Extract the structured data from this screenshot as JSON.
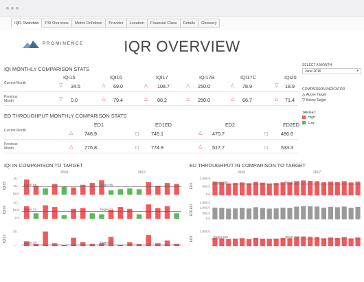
{
  "tabs": [
    "IQR Overview",
    "PSI Overview",
    "Metric Drilldown",
    "Provider",
    "Location",
    "Financial Class",
    "Details",
    "Glossary"
  ],
  "active_tab": 0,
  "brand": {
    "name": "PROMINENCE"
  },
  "page_title": "IQR OVERVIEW",
  "colors": {
    "above": "#e8484d",
    "below": "#3a9f3a",
    "high": "#f0595d",
    "low": "#5cb85c",
    "neutral": "#9a9a9a"
  },
  "iqi_section": {
    "title": "IQI MONTHLY COMPARISON STATS",
    "columns": [
      "IQI15",
      "IQI16",
      "IQI17",
      "IQI17B",
      "IQI17C",
      "IQI20"
    ],
    "rows": [
      {
        "label": "Current Month",
        "cells": [
          {
            "indicator": "down",
            "value": "34.5"
          },
          {
            "indicator": "up",
            "value": "69.0"
          },
          {
            "indicator": "up",
            "value": "108.7"
          },
          {
            "indicator": "up",
            "value": "250.0"
          },
          {
            "indicator": "up",
            "value": "78.9"
          },
          {
            "indicator": "down",
            "value": "18.9"
          }
        ]
      },
      {
        "label": "Previous Month",
        "cells": [
          {
            "indicator": "down",
            "value": "0.0"
          },
          {
            "indicator": "up",
            "value": "79.4"
          },
          {
            "indicator": "up",
            "value": "88.2"
          },
          {
            "indicator": "up",
            "value": "250.0"
          },
          {
            "indicator": "up",
            "value": "66.7"
          },
          {
            "indicator": "up",
            "value": "71.4"
          }
        ]
      }
    ]
  },
  "ed_section": {
    "title": "ED THROUGHPUT MONTHLY COMPARISON STATS",
    "columns": [
      "ED1",
      "ED1ED",
      "ED2",
      "ED2ED"
    ],
    "rows": [
      {
        "label": "Current Month",
        "cells": [
          {
            "indicator": "up",
            "value": "746.9"
          },
          {
            "indicator": "none",
            "value": "745.1"
          },
          {
            "indicator": "up",
            "value": "470.7"
          },
          {
            "indicator": "none",
            "value": "486.6"
          }
        ]
      },
      {
        "label": "Previous Month",
        "cells": [
          {
            "indicator": "up",
            "value": "776.8"
          },
          {
            "indicator": "none",
            "value": "774.9"
          },
          {
            "indicator": "up",
            "value": "517.7"
          },
          {
            "indicator": "none",
            "value": "533.3"
          }
        ]
      }
    ]
  },
  "sidebar": {
    "select_label": "SELECT A MONTH",
    "select_value": "June 2016",
    "indicator_title": "COMPARISON INDICATOR",
    "above_label": "Above Target",
    "below_label": "Below Target",
    "target_title": "TARGET",
    "high_label": "High",
    "low_label": "Low"
  },
  "chart_data": [
    {
      "type": "bar",
      "title": "IQI IN COMPARISON TO TARGET",
      "column_headers": [
        "2016",
        "2017"
      ],
      "panels": [
        {
          "name": "IQI15",
          "ticks": [
            "15...",
            "10...",
            "50.0"
          ],
          "target_labels": [
            "Target 56",
            "Target 56"
          ],
          "colors": [
            "h",
            "h",
            "l",
            "h",
            "l",
            "h",
            "h",
            "h",
            "h",
            "l",
            "l",
            "l",
            "l",
            "h",
            "h",
            "h",
            "h"
          ],
          "values": [
            85,
            50,
            35,
            60,
            45,
            40,
            55,
            65,
            80,
            25,
            30,
            35,
            30,
            70,
            50,
            65,
            60
          ]
        },
        {
          "name": "IQI16",
          "ticks": [
            "10...",
            "50.0",
            "0.0"
          ],
          "target_labels": [
            "Target 31",
            "Target 31"
          ],
          "colors": [
            "h",
            "l",
            "h",
            "h",
            "l",
            "h",
            "h",
            "l",
            "l",
            "h",
            "h",
            "h",
            "l",
            "h",
            "h",
            "h",
            "l"
          ],
          "values": [
            70,
            30,
            75,
            65,
            20,
            55,
            60,
            30,
            25,
            50,
            65,
            55,
            25,
            80,
            60,
            70,
            30
          ]
        },
        {
          "name": "IQI17",
          "ticks": [
            "30...",
            "20..."
          ],
          "target_labels": [
            "Target 83",
            "Target 83"
          ],
          "colors": [
            "h",
            "h",
            "h",
            "h",
            "h",
            "h",
            "h",
            "h",
            "h",
            "h",
            "h",
            "h",
            "h",
            "h",
            "h",
            "h",
            "h"
          ],
          "values": [
            35,
            20,
            90,
            25,
            15,
            55,
            30,
            20,
            25,
            60,
            15,
            30,
            20,
            70,
            25,
            40,
            20
          ]
        }
      ]
    },
    {
      "type": "bar",
      "title": "ED THROUGHPUT IN COMPARISON TO TARGET",
      "column_headers": [
        "2016",
        "2017"
      ],
      "panels": [
        {
          "name": "ED1",
          "ticks": [
            "1,000.0",
            "500.0",
            "0.0"
          ],
          "target_labels": [
            "Target 290",
            "Target 290"
          ],
          "colors": [
            "h",
            "h",
            "h",
            "h",
            "h",
            "h",
            "h",
            "h",
            "h",
            "h",
            "h",
            "h",
            "h",
            "h",
            "h",
            "h",
            "h",
            "h",
            "h",
            "h",
            "h",
            "h"
          ],
          "values": [
            720,
            700,
            640,
            660,
            690,
            650,
            720,
            680,
            640,
            660,
            700,
            690,
            760,
            800,
            780,
            760,
            700,
            740,
            720,
            760,
            690,
            740
          ]
        },
        {
          "name": "ED1ED",
          "ticks": [
            "1,500.0",
            "1,000.0",
            "500.0",
            "0.0"
          ],
          "target_labels": [],
          "colors": [
            "n",
            "n",
            "n",
            "n",
            "n",
            "n",
            "n",
            "n",
            "n",
            "n",
            "n",
            "n",
            "n",
            "n",
            "n",
            "n",
            "n",
            "n",
            "n",
            "n",
            "n",
            "n"
          ],
          "values": [
            700,
            690,
            640,
            660,
            690,
            650,
            720,
            680,
            640,
            660,
            700,
            690,
            760,
            790,
            780,
            760,
            700,
            740,
            720,
            760,
            690,
            740
          ]
        },
        {
          "name": "ED2",
          "ticks": [
            "1,000.0",
            "500.0"
          ],
          "target_labels": [
            "Target 200",
            "Target 200"
          ],
          "colors": [
            "h",
            "h",
            "h",
            "h",
            "h",
            "h",
            "h",
            "h",
            "h",
            "h",
            "h",
            "h",
            "h",
            "h",
            "h",
            "h",
            "h",
            "h",
            "h",
            "h",
            "h",
            "h"
          ],
          "values": [
            560,
            540,
            490,
            520,
            540,
            480,
            560,
            520,
            500,
            520,
            560,
            540,
            600,
            640,
            620,
            600,
            540,
            580,
            560,
            600,
            530,
            580
          ]
        }
      ]
    }
  ]
}
